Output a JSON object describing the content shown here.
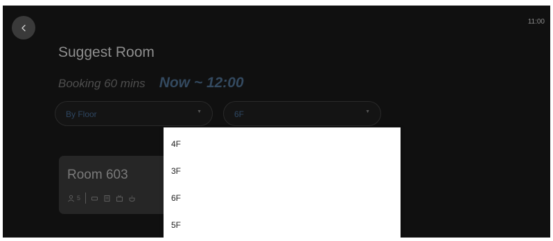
{
  "status_bar": {
    "time": "11:00"
  },
  "header": {
    "back_icon": "chevron-left-icon",
    "title": "Suggest Room"
  },
  "booking": {
    "duration_label": "Booking 60 mins",
    "time_range": "Now ~ 12:00"
  },
  "filters": {
    "floor_mode": {
      "selected": "By Floor"
    },
    "floor": {
      "selected": "6F",
      "options": [
        "4F",
        "3F",
        "6F",
        "5F"
      ]
    }
  },
  "rooms": [
    {
      "name": "Room 603",
      "capacity": "5",
      "amenity_icons": [
        "person-icon",
        "display-icon",
        "whiteboard-icon",
        "tv-icon",
        "coffee-icon"
      ]
    }
  ],
  "colors": {
    "background": "#101010",
    "accent": "#33495f",
    "card": "#262626",
    "dropdown": "#ffffff"
  }
}
